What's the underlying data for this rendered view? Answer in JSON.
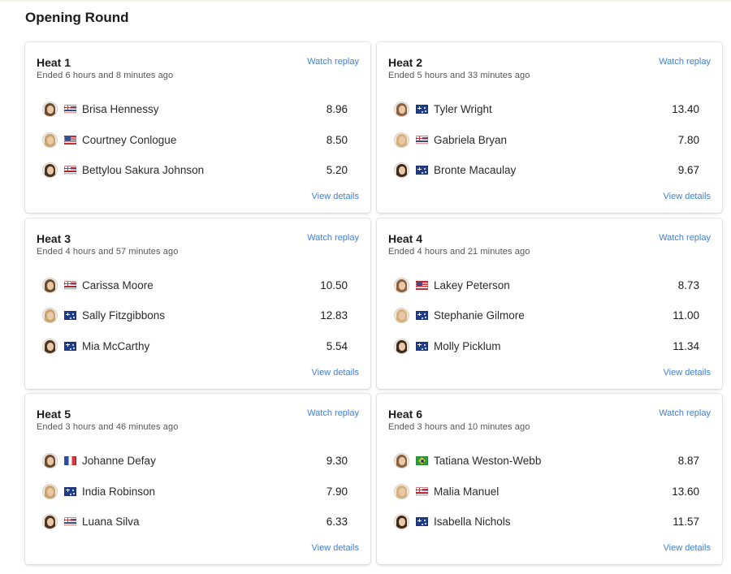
{
  "round_title": "Opening Round",
  "watch_label": "Watch replay",
  "details_label": "View details",
  "colors": {
    "link": "#3f7fd6",
    "title": "#1b1b1b",
    "muted": "#555555"
  },
  "heats": [
    {
      "title": "Heat 1",
      "ended": "Ended 6 hours and 8 minutes ago",
      "surfers": [
        {
          "name": "Brisa Hennessy",
          "flag": "flag-costa-rica",
          "score": "8.96"
        },
        {
          "name": "Courtney Conlogue",
          "flag": "flag-usa",
          "score": "8.50"
        },
        {
          "name": "Bettylou Sakura Johnson",
          "flag": "flag-hawaii",
          "score": "5.20"
        }
      ]
    },
    {
      "title": "Heat 2",
      "ended": "Ended 5 hours and 33 minutes ago",
      "surfers": [
        {
          "name": "Tyler Wright",
          "flag": "flag-australia",
          "score": "13.40"
        },
        {
          "name": "Gabriela Bryan",
          "flag": "flag-hawaii",
          "score": "7.80"
        },
        {
          "name": "Bronte Macaulay",
          "flag": "flag-australia",
          "score": "9.67"
        }
      ]
    },
    {
      "title": "Heat 3",
      "ended": "Ended 4 hours and 57 minutes ago",
      "surfers": [
        {
          "name": "Carissa Moore",
          "flag": "flag-hawaii",
          "score": "10.50"
        },
        {
          "name": "Sally Fitzgibbons",
          "flag": "flag-australia",
          "score": "12.83"
        },
        {
          "name": "Mia McCarthy",
          "flag": "flag-australia",
          "score": "5.54"
        }
      ]
    },
    {
      "title": "Heat 4",
      "ended": "Ended 4 hours and 21 minutes ago",
      "surfers": [
        {
          "name": "Lakey Peterson",
          "flag": "flag-usa",
          "score": "8.73"
        },
        {
          "name": "Stephanie Gilmore",
          "flag": "flag-australia",
          "score": "11.00"
        },
        {
          "name": "Molly Picklum",
          "flag": "flag-australia",
          "score": "11.34"
        }
      ]
    },
    {
      "title": "Heat 5",
      "ended": "Ended 3 hours and 46 minutes ago",
      "surfers": [
        {
          "name": "Johanne Defay",
          "flag": "flag-france",
          "score": "9.30"
        },
        {
          "name": "India Robinson",
          "flag": "flag-australia",
          "score": "7.90"
        },
        {
          "name": "Luana Silva",
          "flag": "flag-hawaii",
          "score": "6.33"
        }
      ]
    },
    {
      "title": "Heat 6",
      "ended": "Ended 3 hours and 10 minutes ago",
      "surfers": [
        {
          "name": "Tatiana Weston-Webb",
          "flag": "flag-brazil",
          "score": "8.87"
        },
        {
          "name": "Malia Manuel",
          "flag": "flag-hawaii",
          "score": "13.60"
        },
        {
          "name": "Isabella Nichols",
          "flag": "flag-australia",
          "score": "11.57"
        }
      ]
    }
  ]
}
